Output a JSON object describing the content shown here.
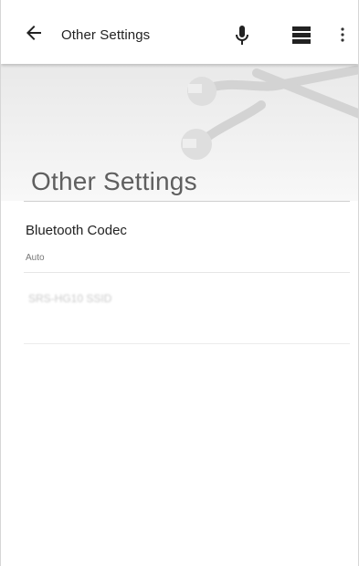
{
  "appbar": {
    "title": "Other Settings",
    "icons": {
      "back": "arrow-left-icon",
      "mic": "microphone-icon",
      "menu": "hamburger-icon",
      "more": "more-vertical-icon"
    }
  },
  "header": {
    "title": "Other Settings",
    "decoration": "wrench-icons"
  },
  "settings": {
    "items": [
      {
        "label": "Bluetooth Codec",
        "value": "Auto"
      },
      {
        "label": "SRS-HG10 SSID"
      }
    ]
  },
  "colors": {
    "header_gradient_top": "#e9e9e9",
    "header_gradient_bottom": "#f8f8f8",
    "title_text": "#5f5f5f"
  }
}
